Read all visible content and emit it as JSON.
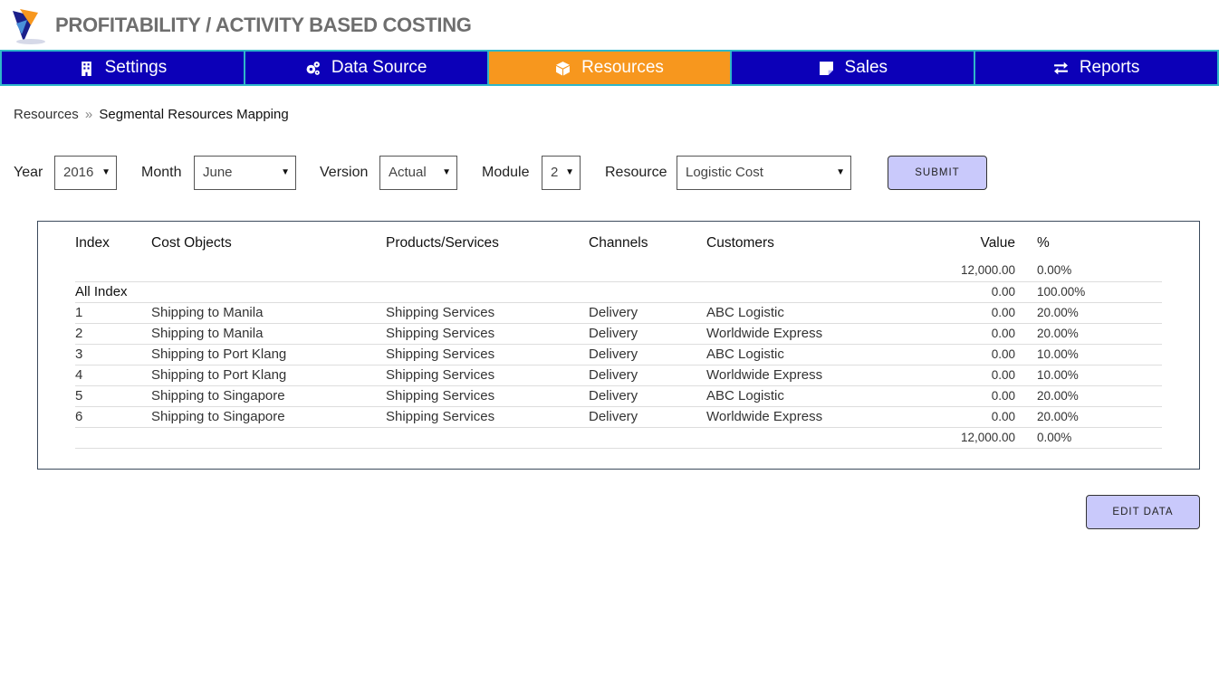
{
  "header": {
    "title": "PROFITABILITY / ACTIVITY BASED COSTING"
  },
  "nav": [
    {
      "label": "Settings",
      "icon": "building-icon",
      "active": false
    },
    {
      "label": "Data Source",
      "icon": "gears-icon",
      "active": false
    },
    {
      "label": "Resources",
      "icon": "cube-icon",
      "active": true
    },
    {
      "label": "Sales",
      "icon": "sticky-note-icon",
      "active": false
    },
    {
      "label": "Reports",
      "icon": "exchange-arrows-icon",
      "active": false
    }
  ],
  "breadcrumb": {
    "root": "Resources",
    "separator": "»",
    "current": "Segmental Resources Mapping"
  },
  "filters": {
    "year_label": "Year",
    "year_value": "2016",
    "month_label": "Month",
    "month_value": "June",
    "version_label": "Version",
    "version_value": "Actual",
    "module_label": "Module",
    "module_value": "2",
    "resource_label": "Resource",
    "resource_value": "Logistic Cost",
    "submit_label": "SUBMIT"
  },
  "table": {
    "headers": {
      "index": "Index",
      "cost": "Cost Objects",
      "product": "Products/Services",
      "channel": "Channels",
      "customer": "Customers",
      "value": "Value",
      "pct": "%"
    },
    "top_total": {
      "value": "12,000.00",
      "pct": "0.00%"
    },
    "all_index": {
      "index": "All Index",
      "value": "0.00",
      "pct": "100.00%"
    },
    "rows": [
      {
        "index": "1",
        "cost": "Shipping to Manila",
        "product": "Shipping Services",
        "channel": "Delivery",
        "customer": "ABC Logistic",
        "value": "0.00",
        "pct": "20.00%"
      },
      {
        "index": "2",
        "cost": "Shipping to Manila",
        "product": "Shipping Services",
        "channel": "Delivery",
        "customer": "Worldwide Express",
        "value": "0.00",
        "pct": "20.00%"
      },
      {
        "index": "3",
        "cost": "Shipping to Port Klang",
        "product": "Shipping Services",
        "channel": "Delivery",
        "customer": "ABC Logistic",
        "value": "0.00",
        "pct": "10.00%"
      },
      {
        "index": "4",
        "cost": "Shipping to Port Klang",
        "product": "Shipping Services",
        "channel": "Delivery",
        "customer": "Worldwide Express",
        "value": "0.00",
        "pct": "10.00%"
      },
      {
        "index": "5",
        "cost": "Shipping to Singapore",
        "product": "Shipping Services",
        "channel": "Delivery",
        "customer": "ABC Logistic",
        "value": "0.00",
        "pct": "20.00%"
      },
      {
        "index": "6",
        "cost": "Shipping to Singapore",
        "product": "Shipping Services",
        "channel": "Delivery",
        "customer": "Worldwide Express",
        "value": "0.00",
        "pct": "20.00%"
      }
    ],
    "bottom_total": {
      "value": "12,000.00",
      "pct": "0.00%"
    }
  },
  "edit_label": "EDIT DATA",
  "colors": {
    "nav_bg": "#0c00b8",
    "nav_active": "#f7971e",
    "nav_border": "#2fb7c9",
    "button_bg": "#c9c9fb"
  }
}
